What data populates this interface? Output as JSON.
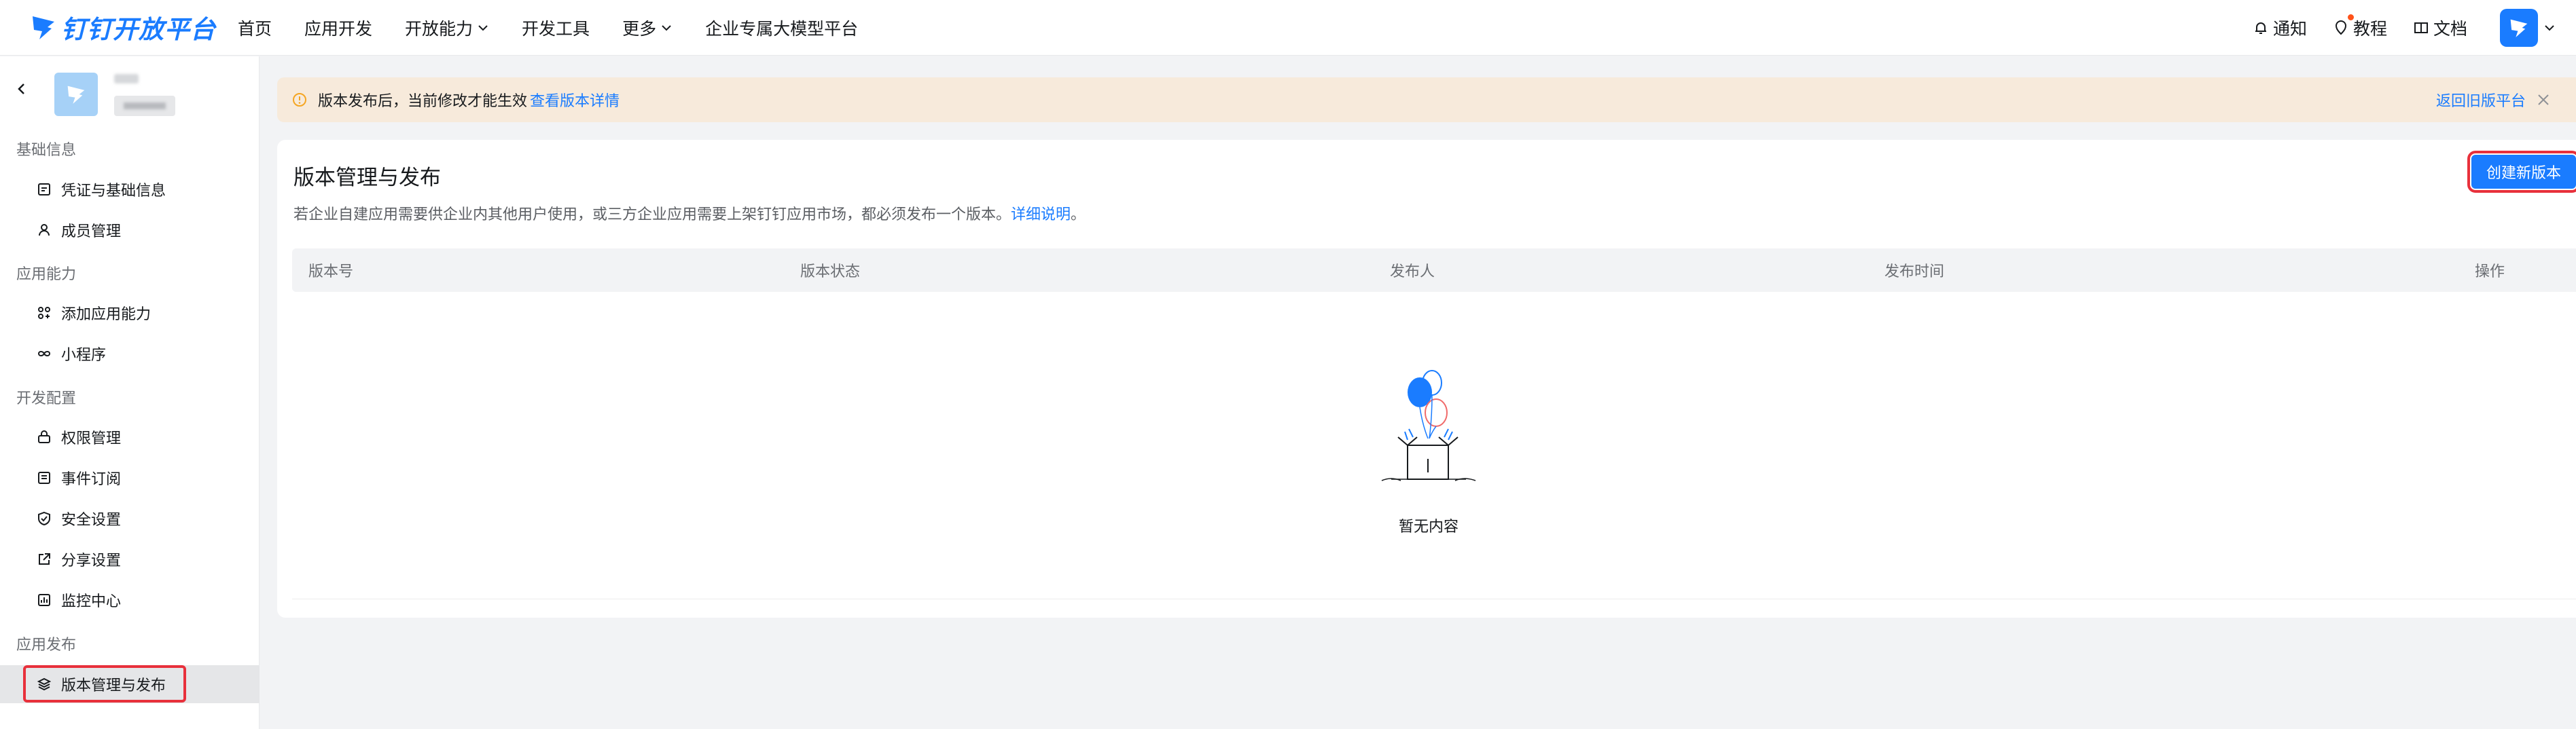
{
  "brand": {
    "name": "钉钉开放平台",
    "color": "#1a7cff"
  },
  "nav": {
    "items": [
      {
        "label": "首页",
        "has_dropdown": false
      },
      {
        "label": "应用开发",
        "has_dropdown": false
      },
      {
        "label": "开放能力",
        "has_dropdown": true
      },
      {
        "label": "开发工具",
        "has_dropdown": false
      },
      {
        "label": "更多",
        "has_dropdown": true
      },
      {
        "label": "企业专属大模型平台",
        "has_dropdown": false
      }
    ]
  },
  "tools": {
    "notify": "通知",
    "tutorial": "教程",
    "docs": "文档"
  },
  "sidebar": {
    "sections": [
      {
        "title": "基础信息"
      },
      {
        "title": "应用能力"
      },
      {
        "title": "开发配置"
      },
      {
        "title": "应用发布"
      }
    ],
    "items": [
      {
        "label": "凭证与基础信息",
        "icon": "credential-icon"
      },
      {
        "label": "成员管理",
        "icon": "user-icon"
      },
      {
        "label": "添加应用能力",
        "icon": "apps-icon"
      },
      {
        "label": "小程序",
        "icon": "mini-program-icon"
      },
      {
        "label": "权限管理",
        "icon": "permission-icon"
      },
      {
        "label": "事件订阅",
        "icon": "event-icon"
      },
      {
        "label": "安全设置",
        "icon": "shield-icon"
      },
      {
        "label": "分享设置",
        "icon": "share-icon"
      },
      {
        "label": "监控中心",
        "icon": "monitor-icon"
      },
      {
        "label": "版本管理与发布",
        "icon": "layers-icon",
        "active": true
      }
    ]
  },
  "notice": {
    "text": "版本发布后，当前修改才能生效",
    "link": "查看版本详情",
    "right_link": "返回旧版平台",
    "bg_color": "#f7eadb"
  },
  "main": {
    "title": "版本管理与发布",
    "description": "若企业自建应用需要供企业内其他用户使用，或三方企业应用需要上架钉钉应用市场，都必须发布一个版本。",
    "description_link": "详细说明",
    "description_end": "。",
    "create_button": "创建新版本",
    "table": {
      "columns": [
        "版本号",
        "版本状态",
        "发布人",
        "发布时间",
        "操作"
      ],
      "rows": []
    },
    "empty_text": "暂无内容"
  },
  "highlight_color": "#e8303b"
}
